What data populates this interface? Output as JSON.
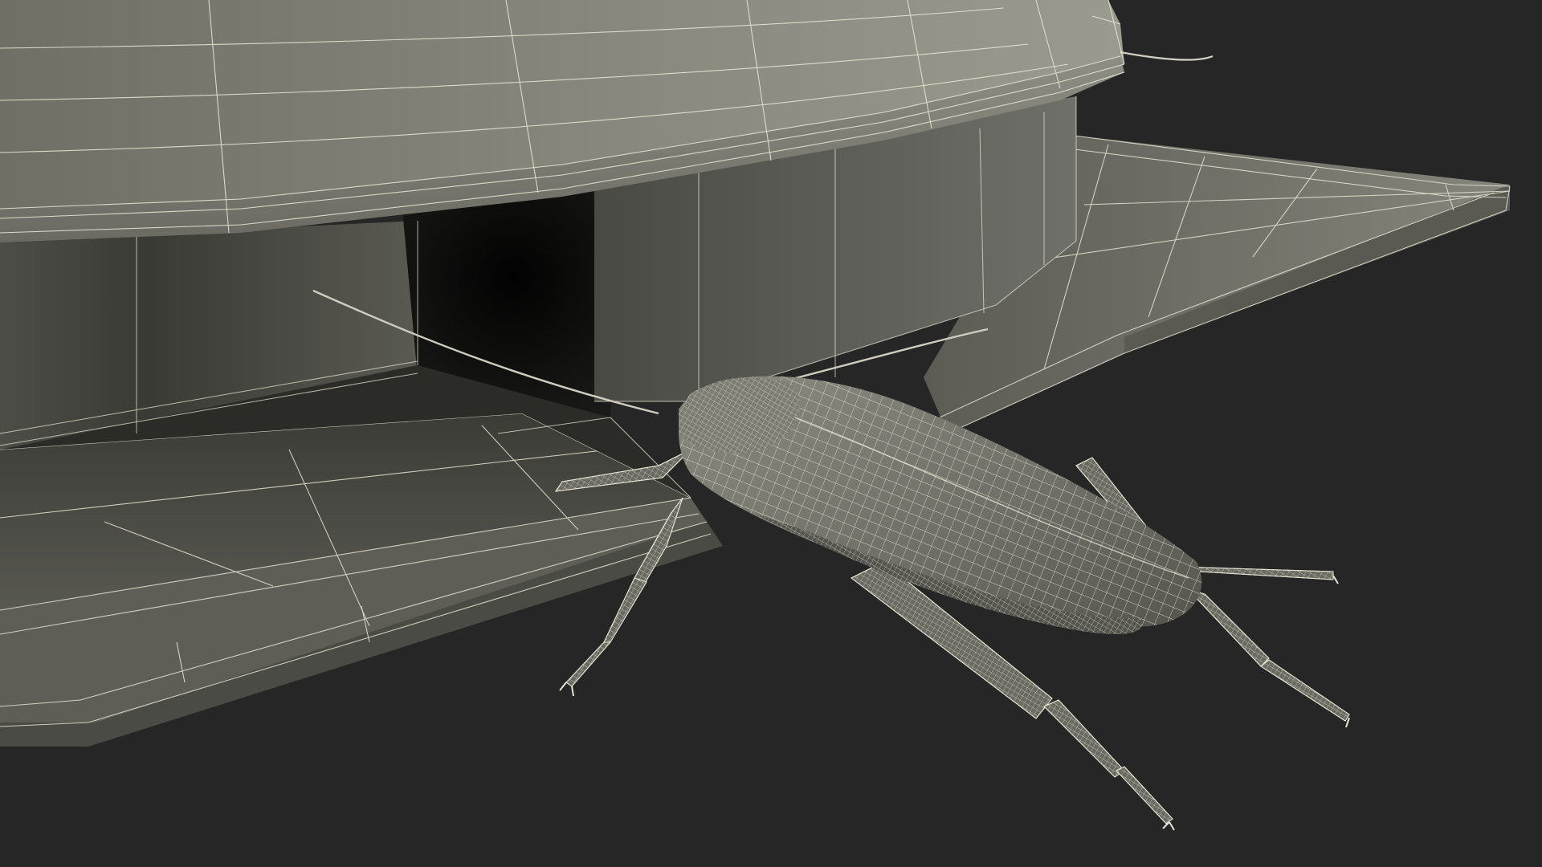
{
  "scene": {
    "subject": "",
    "background_color": "#262626",
    "surface_color": "#7a7a70",
    "shadow_color": "#0b0b0a",
    "wire_color": "#e6e4d2"
  }
}
